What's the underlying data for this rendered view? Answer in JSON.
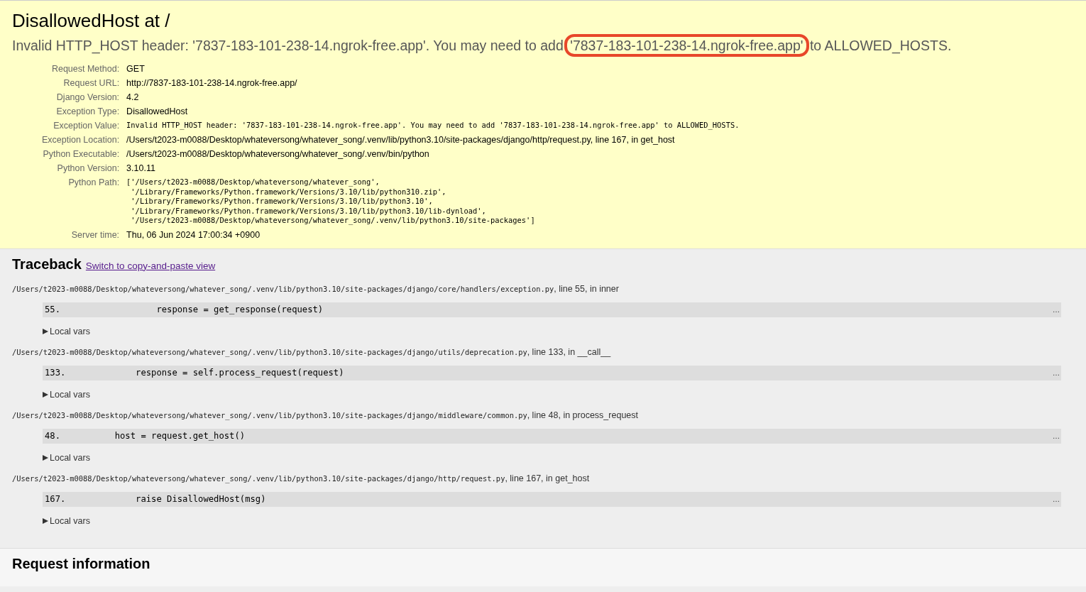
{
  "title": "DisallowedHost at /",
  "message": {
    "before": "Invalid HTTP_HOST header: '7837-183-101-238-14.ngrok-free.app'. You may need to add ",
    "highlighted": "'7837-183-101-238-14.ngrok-free.app'",
    "after": " to ALLOWED_HOSTS."
  },
  "meta": [
    {
      "label": "Request Method:",
      "value": "GET",
      "kind": "text"
    },
    {
      "label": "Request URL:",
      "value": "http://7837-183-101-238-14.ngrok-free.app/",
      "kind": "text"
    },
    {
      "label": "Django Version:",
      "value": "4.2",
      "kind": "text"
    },
    {
      "label": "Exception Type:",
      "value": "DisallowedHost",
      "kind": "text"
    },
    {
      "label": "Exception Value:",
      "value": "Invalid HTTP_HOST header: '7837-183-101-238-14.ngrok-free.app'. You may need to add '7837-183-101-238-14.ngrok-free.app' to ALLOWED_HOSTS.",
      "kind": "code"
    },
    {
      "label": "Exception Location:",
      "value": "/Users/t2023-m0088/Desktop/whateversong/whatever_song/.venv/lib/python3.10/site-packages/django/http/request.py, line 167, in get_host",
      "kind": "text"
    },
    {
      "label": "Python Executable:",
      "value": "/Users/t2023-m0088/Desktop/whateversong/whatever_song/.venv/bin/python",
      "kind": "text"
    },
    {
      "label": "Python Version:",
      "value": "3.10.11",
      "kind": "text"
    },
    {
      "label": "Python Path:",
      "value": "['/Users/t2023-m0088/Desktop/whateversong/whatever_song',\n '/Library/Frameworks/Python.framework/Versions/3.10/lib/python310.zip',\n '/Library/Frameworks/Python.framework/Versions/3.10/lib/python3.10',\n '/Library/Frameworks/Python.framework/Versions/3.10/lib/python3.10/lib-dynload',\n '/Users/t2023-m0088/Desktop/whateversong/whatever_song/.venv/lib/python3.10/site-packages']",
      "kind": "code"
    },
    {
      "label": "Server time:",
      "value": "Thu, 06 Jun 2024 17:00:34 +0900",
      "kind": "text"
    }
  ],
  "traceback": {
    "title": "Traceback",
    "link": "Switch to copy-and-paste view",
    "frames": [
      {
        "file": "/Users/t2023-m0088/Desktop/whateversong/whatever_song/.venv/lib/python3.10/site-packages/django/core/handlers/exception.py",
        "where": ", line 55, in inner",
        "line_no": "55.",
        "code": "                response = get_response(request)",
        "more": "…",
        "vars_label": "Local vars",
        "expanded": false
      },
      {
        "file": "/Users/t2023-m0088/Desktop/whateversong/whatever_song/.venv/lib/python3.10/site-packages/django/utils/deprecation.py",
        "where": ", line 133, in __call__",
        "line_no": "133.",
        "code": "            response = self.process_request(request)",
        "more": "…",
        "vars_label": "Local vars",
        "expanded": false
      },
      {
        "file": "/Users/t2023-m0088/Desktop/whateversong/whatever_song/.venv/lib/python3.10/site-packages/django/middleware/common.py",
        "where": ", line 48, in process_request",
        "line_no": "48.",
        "code": "        host = request.get_host()",
        "more": "…",
        "vars_label": "Local vars",
        "expanded": false
      },
      {
        "file": "/Users/t2023-m0088/Desktop/whateversong/whatever_song/.venv/lib/python3.10/site-packages/django/http/request.py",
        "where": ", line 167, in get_host",
        "line_no": "167.",
        "code": "            raise DisallowedHost(msg)",
        "more": "…",
        "vars_label": "Local vars",
        "expanded": false
      }
    ]
  },
  "request_info": {
    "title": "Request information"
  }
}
